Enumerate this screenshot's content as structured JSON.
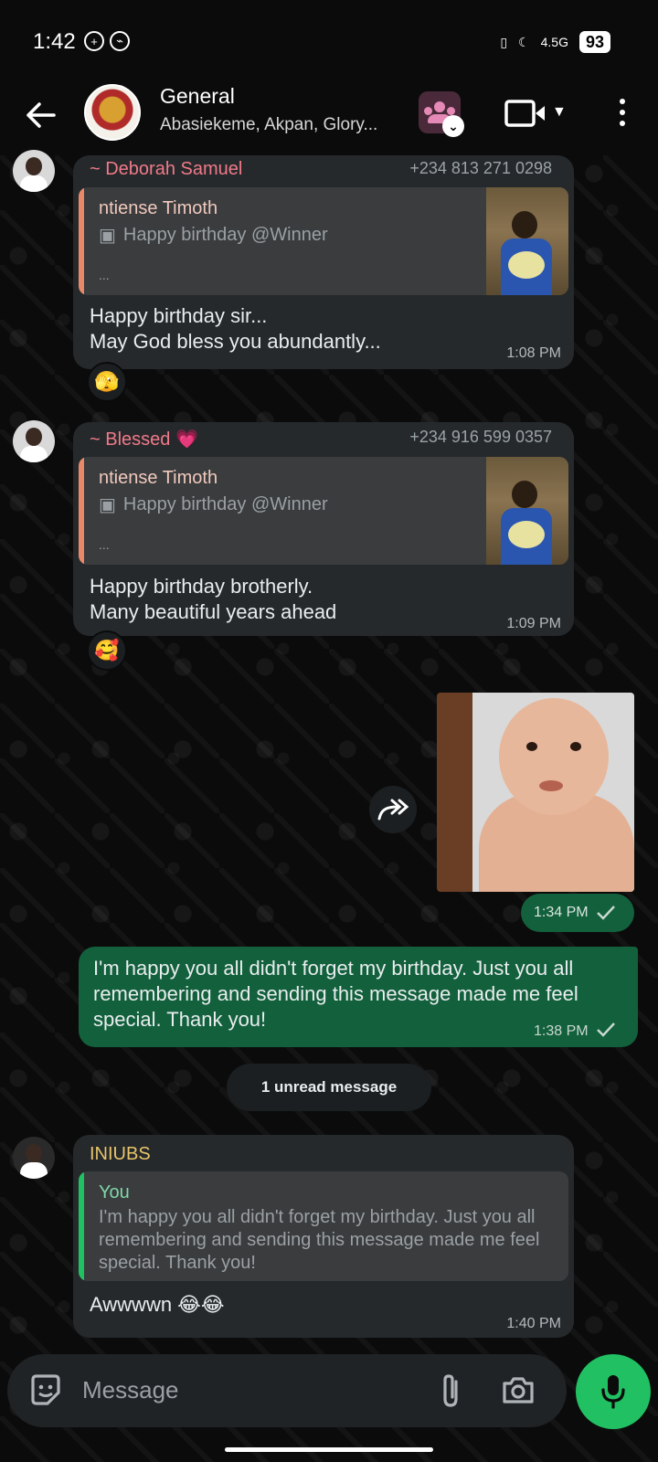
{
  "status_bar": {
    "time": "1:42",
    "network": "4.5G",
    "battery": "93"
  },
  "header": {
    "title": "General",
    "subtitle": "Abasiekeme, Akpan, Glory..."
  },
  "messages": [
    {
      "sender": "~ Deborah Samuel",
      "phone": "+234 813 271 0298",
      "quote_name": "ntiense Timoth",
      "quote_text": "Happy birthday @Winner",
      "quote_more": "...",
      "text_line1": "Happy birthday sir...",
      "text_line2": "May God bless you abundantly...",
      "time": "1:08 PM",
      "reaction": "🫣"
    },
    {
      "sender": "~ Blessed 💗",
      "phone": "+234 916 599 0357",
      "quote_name": "ntiense Timoth",
      "quote_text": "Happy birthday @Winner",
      "quote_more": "...",
      "text_line1": "Happy birthday brotherly.",
      "text_line2": "Many beautiful years ahead",
      "time": "1:09 PM",
      "reaction": "🥰"
    }
  ],
  "image_message": {
    "time": "1:34 PM"
  },
  "outgoing_message": {
    "text": "I'm happy you all didn't forget my birthday. Just you all remembering and sending this message made me feel special. Thank you!",
    "time": "1:38 PM"
  },
  "unread_banner": "1 unread message",
  "reply_message": {
    "sender": "INIUBS",
    "quote_name": "You",
    "quote_text": "I'm happy you all didn't forget my birthday. Just you all remembering and sending this message made me feel special. Thank you!",
    "text": "Awwwwn 😂😂",
    "time": "1:40 PM"
  },
  "composer": {
    "placeholder": "Message"
  },
  "colors": {
    "accent_green": "#21c063",
    "outgoing_bubble": "#12603c",
    "sender1": "#f07a8a",
    "sender2": "#f07a8a",
    "sender3": "#e7c46a",
    "quote_bar_orange": "#e88a6a",
    "quote_bar_green": "#21c063"
  }
}
